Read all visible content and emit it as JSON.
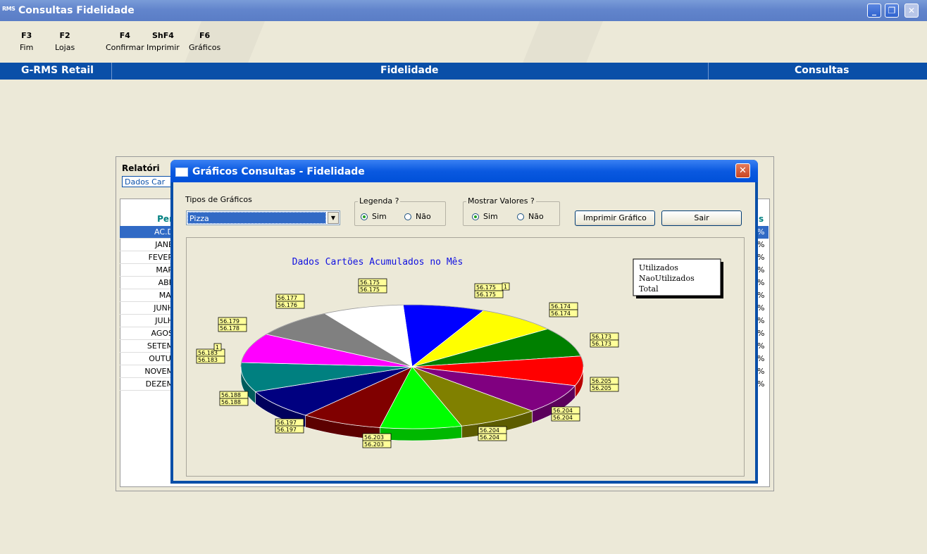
{
  "window": {
    "title": "Consultas Fidelidade",
    "app_icon": "RMS"
  },
  "fkeys": [
    {
      "key": "F3",
      "label": "Fim"
    },
    {
      "key": "F2",
      "label": "Lojas"
    },
    {
      "key": "F4",
      "label": "Confirmar"
    },
    {
      "key": "ShF4",
      "label": "Imprimir"
    },
    {
      "key": "F6",
      "label": "Gráficos"
    }
  ],
  "header": {
    "left": "G-RMS Retail",
    "center": "Fidelidade",
    "right": "Consultas"
  },
  "report": {
    "title": "Relatóri",
    "subtitle": "Dados Car",
    "column_header": "Per",
    "right_header": "s",
    "rows": [
      "AC.D",
      "JANE",
      "FEVER",
      "MAR",
      "ABF",
      "MAI",
      "JUNH",
      "JULH",
      "AGOS",
      "SETEM",
      "OUTUI",
      "NOVEM",
      "DEZEM"
    ],
    "pct": "%"
  },
  "dialog": {
    "title": "Gráficos Consultas - Fidelidade",
    "tipos_label": "Tipos de Gráficos",
    "tipo_value": "Pizza",
    "legenda_label": "Legenda ?",
    "mostrar_label": "Mostrar Valores ?",
    "sim": "Sim",
    "nao": "Não",
    "print_button": "Imprimir Gráfico",
    "exit_button": "Sair"
  },
  "chart_data": {
    "type": "pie",
    "title": "Dados Cartões Acumulados no Mês",
    "legend": [
      "Utilizados",
      "NaoUtilizados",
      "Total"
    ],
    "legend_position": "top-right",
    "slices": [
      {
        "color": "#0000FF",
        "labels": [
          "56.175",
          "56.175"
        ]
      },
      {
        "color": "#FFFF00",
        "labels": [
          "56.175",
          "56.175"
        ]
      },
      {
        "color": "#008000",
        "labels": [
          "56.174",
          "56.174"
        ]
      },
      {
        "color": "#FF0000",
        "labels": [
          "56.173",
          "56.173"
        ]
      },
      {
        "color": "#800080",
        "labels": [
          "56.205",
          "56.205"
        ]
      },
      {
        "color": "#808000",
        "labels": [
          "56.204",
          "56.204"
        ]
      },
      {
        "color": "#00FF00",
        "labels": [
          "56.204",
          "56.204"
        ]
      },
      {
        "color": "#800000",
        "labels": [
          "56.203",
          "56.203"
        ]
      },
      {
        "color": "#000080",
        "labels": [
          "56.197",
          "56.197"
        ]
      },
      {
        "color": "#008080",
        "labels": [
          "56.188",
          "56.188"
        ]
      },
      {
        "color": "#FF00FF",
        "labels": [
          "56.183",
          "56.183"
        ]
      },
      {
        "color": "#808080",
        "labels": [
          "56.179",
          "56.178"
        ]
      },
      {
        "color": "#FFFFFF",
        "labels": [
          "56.177",
          "56.176"
        ]
      }
    ],
    "extra_labels": [
      "1",
      "1"
    ]
  }
}
